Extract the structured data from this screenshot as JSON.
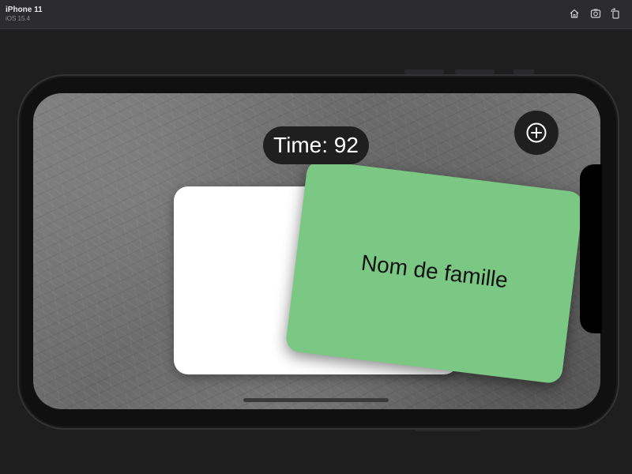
{
  "simulator": {
    "device_name": "iPhone 11",
    "os_version": "iOS 15.4"
  },
  "toolbar": {
    "icons": [
      "home-icon",
      "screenshot-icon",
      "rotate-icon"
    ]
  },
  "app": {
    "timer_label": "Time: 92",
    "add_icon": "plus-circle-icon",
    "front_card_text": "Nom de famille",
    "front_card_color": "#7bc784",
    "back_card_color": "#ffffff"
  }
}
